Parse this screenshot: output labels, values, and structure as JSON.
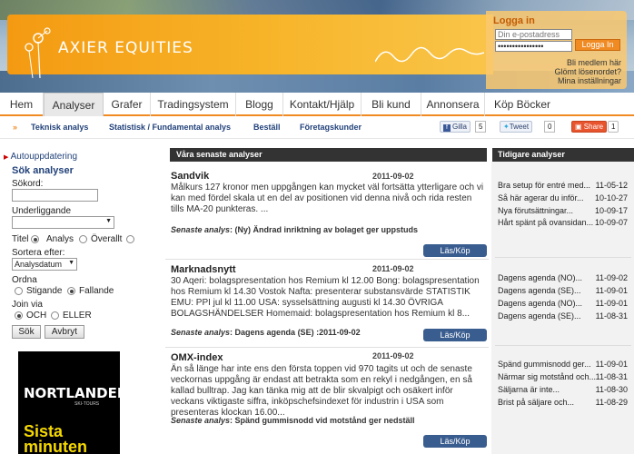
{
  "brand": {
    "name": "AXIER EQUITIES"
  },
  "login": {
    "title": "Logga in",
    "email_placeholder": "Din e-postadress",
    "password_mask": "••••••••••••••••",
    "button": "Logga In",
    "links": [
      "Bli medlem här",
      "Glömt lösenordet?",
      "Mina inställningar"
    ]
  },
  "nav": [
    "Hem",
    "Analyser",
    "Grafer",
    "Tradingsystem",
    "Blogg",
    "Kontakt/Hjälp",
    "Bli kund",
    "Annonsera",
    "Köp Böcker"
  ],
  "subnav": {
    "arrows": "»",
    "items": [
      "Teknisk analys",
      "Statistisk / Fundamental analys",
      "Beställ",
      "Företagskunder"
    ],
    "like": "Gilla",
    "like_count": "5",
    "tweet": "Tweet",
    "tweet_count": "0",
    "share": "Share",
    "share_count": "1"
  },
  "sidebar": {
    "autoupdate": "Autouppdatering",
    "search_title": "Sök analyser",
    "search_label": "Sökord:",
    "underlying_label": "Underliggande",
    "title_label": "Titel",
    "analysis_label": "Analys",
    "overall_label": "Överallt",
    "sort_label": "Sortera efter:",
    "sort_value": "Analysdatum",
    "order_label": "Ordna",
    "asc_label": "Stigande",
    "desc_label": "Fallande",
    "join_label": "Join via",
    "and_label": "OCH",
    "or_label": "ELLER",
    "search_button": "Sök",
    "cancel_button": "Avbryt"
  },
  "ad": {
    "brand": "NORTLANDER",
    "tag": "SKI-TOURS",
    "cta": "Sista minuten skidresor"
  },
  "center": {
    "header": "Våra senaste analyser",
    "latest_prefix": "Senaste analys",
    "read_buy": "Läs/Köp",
    "posts": [
      {
        "title": "Sandvik",
        "date": "2011-09-02",
        "body": "Målkurs 127 kronor men uppgången kan mycket väl fortsätta ytterligare och vi kan med fördel skala ut en del av positionen vid denna nivå och rida resten tills MA-20 punkteras. ...",
        "latest": ": (Ny) Ändrad inriktning av bolaget ger uppstuds"
      },
      {
        "title": "Marknadsnytt",
        "date": "2011-09-02",
        "body": "30 Aqeri: bolagspresentation hos Remium kl 12.00 Bong: bolagspresentation hos Remium kl 14.30 Vostok Nafta: presenterar substansvärde STATISTIK EMU: PPI jul kl 11.00 USA: sysselsättning augusti kl 14.30 ÖVRIGA BOLAGSHÄNDELSER Homemaid: bolagspresentation hos Remium kl 8...",
        "latest": ": Dagens agenda (SE) :2011-09-02"
      },
      {
        "title": "OMX-index",
        "date": "2011-09-02",
        "body": "Än så länge har inte ens den första toppen vid 970 tagits ut och de senaste veckornas uppgång är endast att betrakta som en rekyl i nedgången, en så kallad bulltrap. Jag kan tänka mig att de blir skvalpigt och osäkert inför veckans viktigaste siffra, inköpschefsindexet för industrin i USA som presenteras klockan 16.00...",
        "latest": ": Spänd gummisnodd vid motstånd ger nedställ"
      }
    ]
  },
  "right": {
    "header": "Tidigare analyser",
    "groups": [
      [
        {
          "title": "Bra setup för entré med...",
          "date": "11-05-12"
        },
        {
          "title": "Så här agerar du inför...",
          "date": "10-10-27"
        },
        {
          "title": "Nya förutsättningar...",
          "date": "10-09-17"
        },
        {
          "title": "Hårt spänt på ovansidan...",
          "date": "10-09-07"
        }
      ],
      [
        {
          "title": "Dagens agenda (NO)...",
          "date": "11-09-02"
        },
        {
          "title": "Dagens agenda (SE)...",
          "date": "11-09-01"
        },
        {
          "title": "Dagens agenda (NO)...",
          "date": "11-09-01"
        },
        {
          "title": "Dagens agenda (SE)...",
          "date": "11-08-31"
        }
      ],
      [
        {
          "title": "Spänd gummisnodd ger...",
          "date": "11-09-01"
        },
        {
          "title": "Närmar sig motstånd och...",
          "date": "11-08-31"
        },
        {
          "title": "Säljarna är inte...",
          "date": "11-08-30"
        },
        {
          "title": "Brist på säljare och...",
          "date": "11-08-29"
        }
      ]
    ]
  }
}
